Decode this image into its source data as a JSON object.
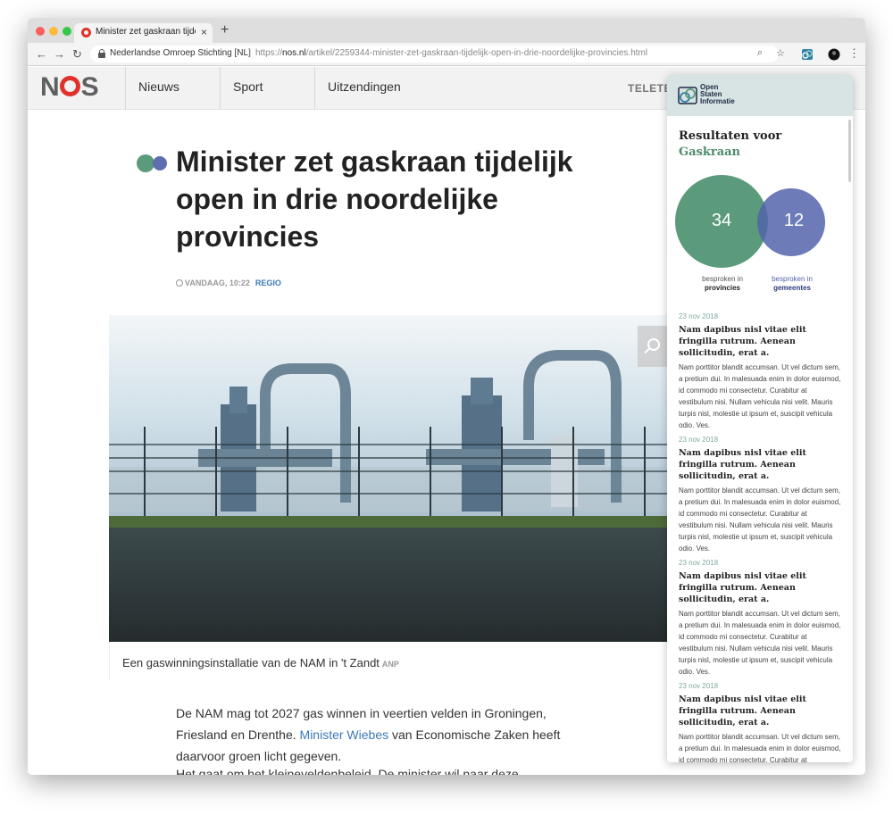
{
  "browser": {
    "tab_title": "Minister zet gaskraan tijdelijk o",
    "tab_close": "×",
    "new_tab": "+",
    "back": "←",
    "forward": "→",
    "reload": "↻",
    "site_identity": "Nederlandse Omroep Stichting [NL]",
    "separator": "|",
    "url_prefix": "https://",
    "url_domain": "nos.nl",
    "url_path": "/artikel/2259344-minister-zet-gaskraan-tijdelijk-open-in-drie-noordelijke-provincies.html",
    "zoom_icon": "⌕",
    "star_icon": "☆",
    "menu_icon": "⋮"
  },
  "nos": {
    "logo_n": "N",
    "logo_s": "S",
    "nav": [
      "Nieuws",
      "Sport",
      "Uitzendingen"
    ],
    "teletekst": "TELETEK"
  },
  "article": {
    "headline": "Minister zet gaskraan tijdelijk open in drie noordelijke provincies",
    "timestamp": "VANDAAG, 10:22",
    "region": "REGIO",
    "caption": "Een gaswinningsinstallatie van de NAM in 't Zandt",
    "credit": "ANP",
    "para1_a": "De NAM mag tot 2027 gas winnen in veertien velden in Groningen, Friesland en Drenthe.",
    "para1_link": "Minister Wiebes",
    "para1_b": "van Economische Zaken heeft daarvoor groen licht gegeven.",
    "para2": "Het gaat om het kleineveldenbeleid. De minister wil naar deze"
  },
  "panel": {
    "brand_line1": "Open",
    "brand_line2": "Staten",
    "brand_line3": "Informatie",
    "results_for": "Resultaten voor",
    "query": "Gaskraan",
    "count_provinces": "34",
    "count_municipalities": "12",
    "label_prov_top": "besproken in",
    "label_prov_bottom": "provincies",
    "label_gem_top": "besproken in",
    "label_gem_bottom": "gemeentes",
    "colors": {
      "provinces": "#5b9b7c",
      "municipalities": "#5464ac",
      "header": "#d8e3e3"
    },
    "results": [
      {
        "date": "23 nov 2018",
        "title": "Nam dapibus nisl vitae elit fringilla rutrum. Aenean sollicitudin, erat a.",
        "text": "Nam porttitor blandit accumsan. Ut vel dictum sem, a pretium dui. In malesuada enim in dolor euismod, id commodo mi consectetur. Curabitur at vestibulum nisi. Nullam vehicula nisi velit. Mauris turpis nisl, molestie ut ipsum et, suscipit vehicula odio. Ves."
      },
      {
        "date": "23 nov 2018",
        "title": "Nam dapibus nisl vitae elit fringilla rutrum. Aenean sollicitudin, erat a.",
        "text": "Nam porttitor blandit accumsan. Ut vel dictum sem, a pretium dui. In malesuada enim in dolor euismod, id commodo mi consectetur. Curabitur at vestibulum nisi. Nullam vehicula nisi velit. Mauris turpis nisl, molestie ut ipsum et, suscipit vehicula odio. Ves."
      },
      {
        "date": "23 nov 2018",
        "title": "Nam dapibus nisl vitae elit fringilla rutrum. Aenean sollicitudin, erat a.",
        "text": "Nam porttitor blandit accumsan. Ut vel dictum sem, a pretium dui. In malesuada enim in dolor euismod, id commodo mi consectetur. Curabitur at vestibulum nisi. Nullam vehicula nisi velit. Mauris turpis nisl, molestie ut ipsum et, suscipit vehicula odio. Ves."
      },
      {
        "date": "23 nov 2018",
        "title": "Nam dapibus nisl vitae elit fringilla rutrum. Aenean sollicitudin, erat a.",
        "text": "Nam porttitor blandit accumsan. Ut vel dictum sem, a pretium dui. In malesuada enim in dolor euismod, id commodo mi consectetur. Curabitur at vestibulum nisi. Nullam vehicula nisi velit."
      }
    ]
  }
}
